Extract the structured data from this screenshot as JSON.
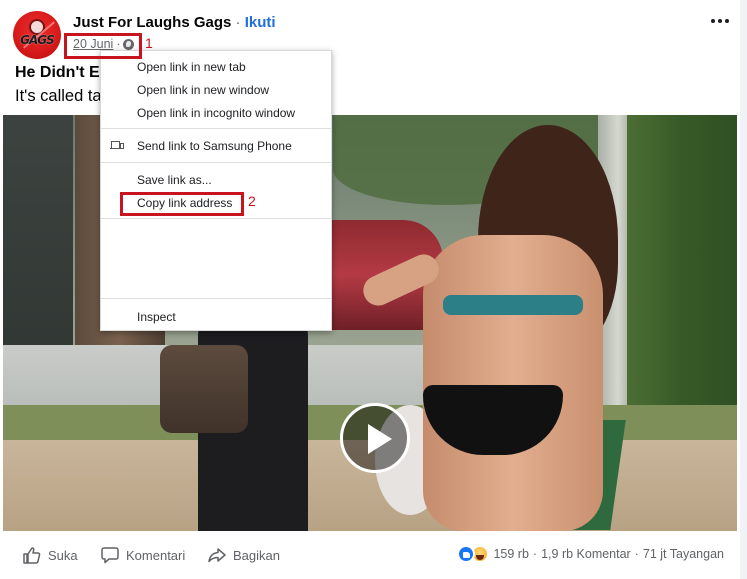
{
  "post": {
    "page_name": "Just For Laughs Gags",
    "separator": "·",
    "follow_label": "Ikuti",
    "date": "20 Juni",
    "meta_separator": "·",
    "privacy_icon": "globe-icon",
    "title": "He Didn't E",
    "body": "It's called ta",
    "avatar_text": "GAGS",
    "more_icon": "more-options-icon",
    "video_play_icon": "play-icon"
  },
  "annotations": [
    {
      "label": "1",
      "color": "#c8141e"
    },
    {
      "label": "2",
      "color": "#c8141e"
    }
  ],
  "context_menu": {
    "items": [
      {
        "label": "Open link in new tab"
      },
      {
        "label": "Open link in new window"
      },
      {
        "label": "Open link in incognito window"
      },
      {
        "label": "Send link to Samsung Phone",
        "icon": "device-icon"
      },
      {
        "label": "Save link as..."
      },
      {
        "label": "Copy link address"
      },
      {
        "label": "Inspect"
      }
    ]
  },
  "actions": {
    "like_label": "Suka",
    "comment_label": "Komentari",
    "share_label": "Bagikan"
  },
  "stats": {
    "reactions_count": "159 rb",
    "comments": "1,9 rb Komentar",
    "views": "71 jt Tayangan",
    "separator": "·"
  },
  "colors": {
    "link_blue": "#216fdb",
    "annotation_red": "#c8141e",
    "like_blue": "#1877f2"
  }
}
